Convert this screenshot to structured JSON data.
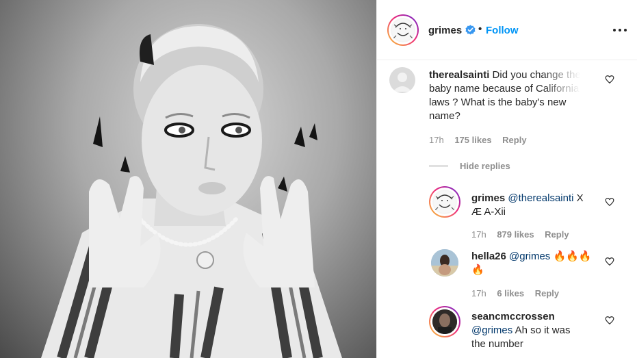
{
  "post": {
    "author": "grimes",
    "separator": "•",
    "follow_label": "Follow"
  },
  "comments": [
    {
      "user": "therealsainti",
      "text": "Did you change the baby name because of Californian laws ? What is the baby's new name?",
      "time": "17h",
      "likes": "175 likes",
      "reply_label": "Reply"
    }
  ],
  "replies_toggle": "Hide replies",
  "replies": [
    {
      "user": "grimes",
      "mention": "@therealsainti",
      "text_line1": "X",
      "text_line2": "Æ A-Xii",
      "time": "17h",
      "likes": "879 likes",
      "reply_label": "Reply"
    },
    {
      "user": "hella26",
      "mention": "@grimes",
      "emoji": "🔥🔥🔥",
      "emoji2": "🔥",
      "time": "17h",
      "likes": "6 likes",
      "reply_label": "Reply"
    },
    {
      "user": "seancmccrossen",
      "mention": "@grimes",
      "text_line1": "Ah so it was",
      "text_line2": "the number"
    }
  ],
  "colors": {
    "accent": "#0095f6",
    "mention": "#00376b",
    "muted": "#8e8e8e",
    "verified": "#3897f0"
  },
  "icons": [
    "verified-badge-icon",
    "more-options-icon",
    "heart-icon",
    "default-avatar-icon"
  ]
}
